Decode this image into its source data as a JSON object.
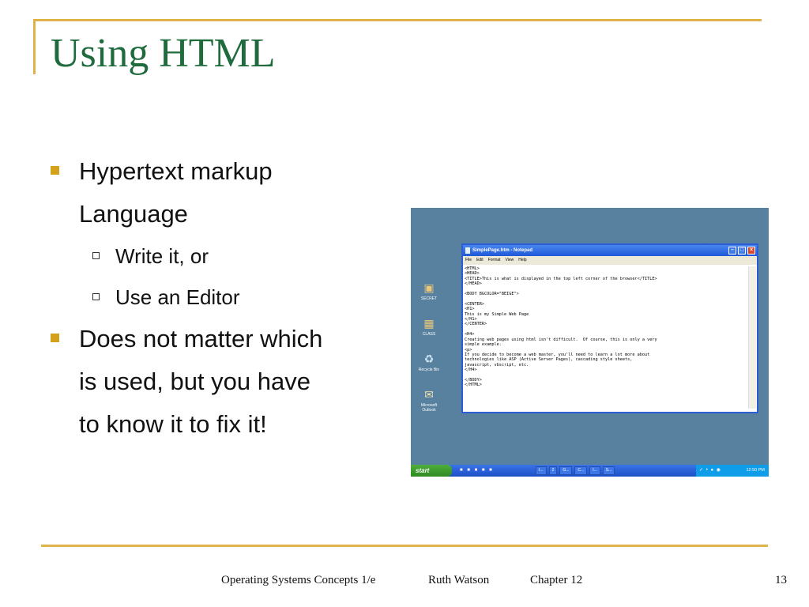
{
  "slide": {
    "title": "Using HTML",
    "bullets": [
      {
        "level": 1,
        "text": "Hypertext markup"
      },
      {
        "level": 1,
        "text": "Language"
      },
      {
        "level": 2,
        "text": "Write it, or"
      },
      {
        "level": 2,
        "text": "Use an Editor"
      },
      {
        "level": 1,
        "text": "Does not matter which"
      },
      {
        "level": 1,
        "text": "is used, but you have"
      },
      {
        "level": 1,
        "text": "to know it to fix it!"
      }
    ],
    "footer": {
      "course": "Operating Systems Concepts 1/e",
      "author": "Ruth Watson",
      "chapter": "Chapter 12",
      "page": "13"
    },
    "colors": {
      "accent": "#e0b24a",
      "title": "#1f6b3e",
      "bullet": "#d4a21a"
    }
  },
  "screenshot": {
    "desktop_icons": [
      {
        "icon": "folder-icon",
        "label": "SECRET"
      },
      {
        "icon": "folder-icon",
        "label": "CLASS"
      },
      {
        "icon": "recycle-bin-icon",
        "label": "Recycle Bin"
      },
      {
        "icon": "outlook-icon",
        "label": "Microsoft Outlook"
      }
    ],
    "notepad": {
      "title": "SimplePage.htm - Notepad",
      "menu": [
        "File",
        "Edit",
        "Format",
        "View",
        "Help"
      ],
      "content": "<HTML>\n<HEAD>\n<TITLE>This is what is displayed in the top left corner of the browser</TITLE>\n</HEAD>\n\n<BODY BGCOLOR=\"BEIGE\">\n\n<CENTER>\n<H1>\nThis is my Simple Web Page\n</H1>\n</CENTER>\n\n<H4>\nCreating web pages using html isn't difficult.  Of course, this is only a very\nsimple example.\n<p>\nIf you decide to become a web master, you'll need to learn a lot more about\ntechnologies like ASP (Active Server Pages), cascading style sheets,\njavascript, vbscript, etc.\n</H4>\n\n</BODY>\n</HTML>"
    },
    "taskbar": {
      "start_label": "start",
      "items": [
        "I...",
        "2",
        "G...",
        "C...",
        "I...",
        "S..."
      ],
      "clock": "12:50 PM"
    }
  }
}
